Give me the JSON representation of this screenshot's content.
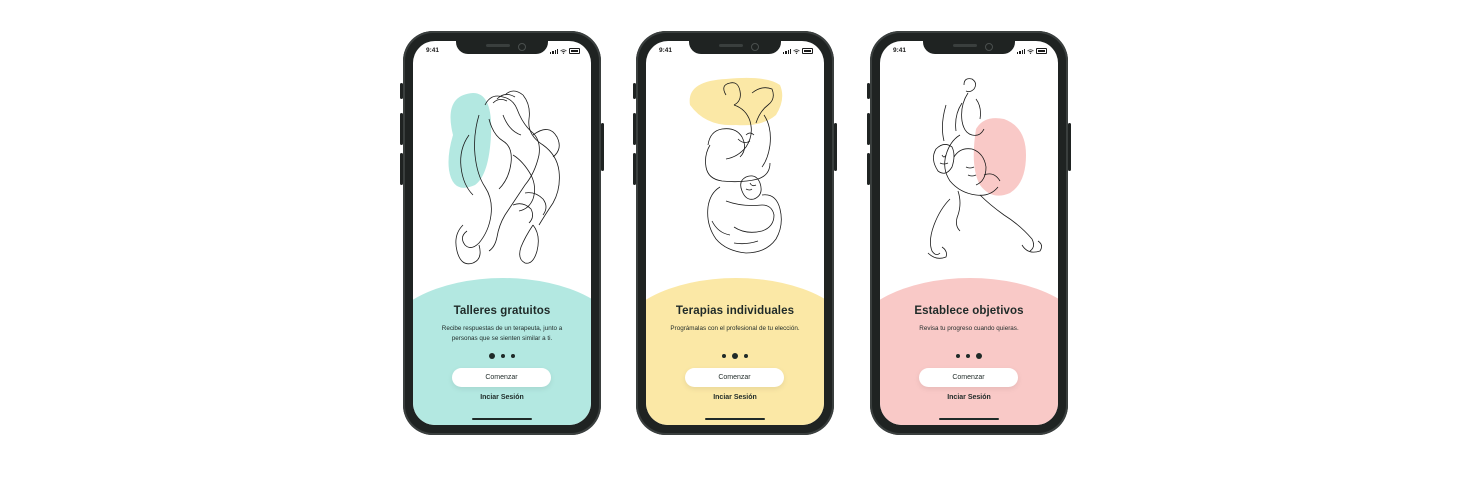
{
  "screens": [
    {
      "status_time": "9:41",
      "title": "Talleres gratuitos",
      "subtitle": "Recibe respuestas de un terapeuta, junto a personas que se sienten similar a ti.",
      "primary_button": "Comenzar",
      "secondary_link": "Inciar Sesión",
      "active_dot": 1,
      "accent_color": "#b3e8e1",
      "illustration": "hands-illustration"
    },
    {
      "status_time": "9:41",
      "title": "Terapias individuales",
      "subtitle": "Prográmalas con el profesional de tu elección.",
      "primary_button": "Comenzar",
      "secondary_link": "Inciar Sesión",
      "active_dot": 2,
      "accent_color": "#fbe8a6",
      "illustration": "hugging-people-illustration"
    },
    {
      "status_time": "9:41",
      "title": "Establece objetivos",
      "subtitle": "Revisa tu progreso cuando quieras.",
      "primary_button": "Comenzar",
      "secondary_link": "Inciar Sesión",
      "active_dot": 3,
      "accent_color": "#f9c9c7",
      "illustration": "walking-people-illustration"
    }
  ]
}
